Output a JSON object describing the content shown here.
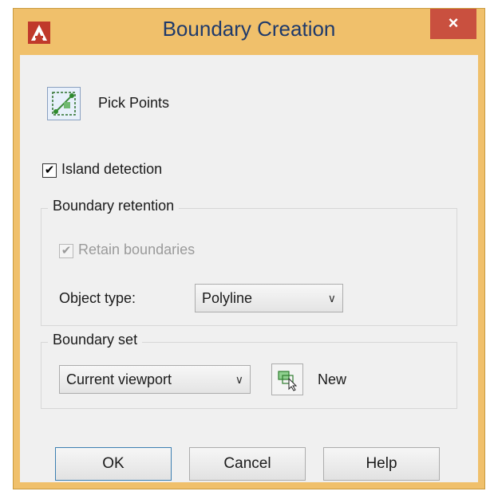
{
  "window": {
    "title": "Boundary Creation",
    "close_label": "×",
    "app_icon": "autocad-logo-icon",
    "frame_color": "#f0c06b",
    "close_color": "#c9503f"
  },
  "pick_points": {
    "label": "Pick Points",
    "icon": "pick-points-icon"
  },
  "island_detection": {
    "label": "Island detection",
    "checked": true,
    "check_glyph": "✔"
  },
  "boundary_retention": {
    "title": "Boundary retention",
    "retain_label": "Retain boundaries",
    "retain_checked": true,
    "retain_disabled": true,
    "check_glyph": "✔",
    "object_type_label": "Object type:",
    "object_type_value": "Polyline",
    "chevron": "∨"
  },
  "boundary_set": {
    "title": "Boundary set",
    "set_value": "Current viewport",
    "chevron": "∨",
    "new_icon": "select-objects-icon",
    "new_label": "New"
  },
  "buttons": {
    "ok": "OK",
    "cancel": "Cancel",
    "help": "Help"
  }
}
